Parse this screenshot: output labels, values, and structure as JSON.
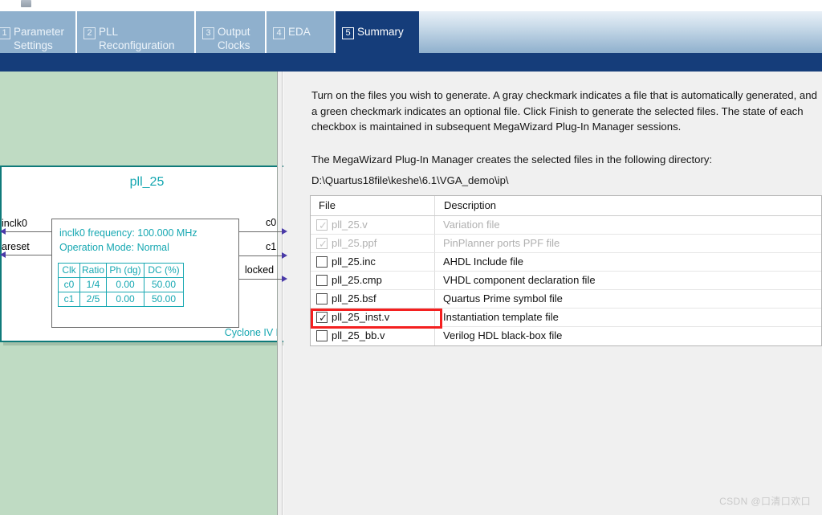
{
  "window": {
    "top_icon": "document-icon"
  },
  "tabs": [
    {
      "num": "1",
      "label": "Parameter Settings",
      "active": false
    },
    {
      "num": "2",
      "label": "PLL Reconfiguration",
      "active": false
    },
    {
      "num": "3",
      "label": "Output Clocks",
      "active": false
    },
    {
      "num": "4",
      "label": "EDA",
      "active": false
    },
    {
      "num": "5",
      "label": "Summary",
      "active": true
    }
  ],
  "symbol": {
    "title": "pll_25",
    "device": "Cyclone IV E",
    "info_line1": "inclk0 frequency: 100.000 MHz",
    "info_line2": "Operation Mode: Normal",
    "clock_table": {
      "headers": [
        "Clk",
        "Ratio",
        "Ph (dg)",
        "DC (%)"
      ],
      "rows": [
        [
          "c0",
          "1/4",
          "0.00",
          "50.00"
        ],
        [
          "c1",
          "2/5",
          "0.00",
          "50.00"
        ]
      ]
    },
    "inputs": [
      "inclk0",
      "areset"
    ],
    "outputs": [
      "c0",
      "c1",
      "locked"
    ]
  },
  "instructions": {
    "paragraph1": "Turn on the files you wish to generate. A gray checkmark indicates a file that is automatically generated, and a green checkmark indicates an optional file. Click Finish to generate the selected files. The state of each checkbox is maintained in subsequent MegaWizard Plug-In Manager sessions.",
    "paragraph2": "The MegaWizard Plug-In Manager creates the selected files in the following directory:",
    "directory": "D:\\Quartus18file\\keshe\\6.1\\VGA_demo\\ip\\"
  },
  "file_table": {
    "headers": {
      "file": "File",
      "description": "Description"
    },
    "rows": [
      {
        "file": "pll_25.v",
        "description": "Variation file",
        "checked": true,
        "disabled": true,
        "highlighted": false
      },
      {
        "file": "pll_25.ppf",
        "description": "PinPlanner ports PPF file",
        "checked": true,
        "disabled": true,
        "highlighted": false
      },
      {
        "file": "pll_25.inc",
        "description": "AHDL Include file",
        "checked": false,
        "disabled": false,
        "highlighted": false
      },
      {
        "file": "pll_25.cmp",
        "description": "VHDL component declaration file",
        "checked": false,
        "disabled": false,
        "highlighted": false
      },
      {
        "file": "pll_25.bsf",
        "description": "Quartus Prime symbol file",
        "checked": false,
        "disabled": false,
        "highlighted": false
      },
      {
        "file": "pll_25_inst.v",
        "description": "Instantiation template file",
        "checked": true,
        "disabled": false,
        "highlighted": true
      },
      {
        "file": "pll_25_bb.v",
        "description": "Verilog HDL black-box file",
        "checked": false,
        "disabled": false,
        "highlighted": false
      }
    ]
  },
  "watermark": "CSDN @口清口欢口",
  "colors": {
    "tab_inactive": "#8fb0cd",
    "tab_active": "#153d7a",
    "green_panel": "#bfdbc3",
    "symbol_teal": "#14a6b0",
    "highlight_red": "#f42020"
  }
}
